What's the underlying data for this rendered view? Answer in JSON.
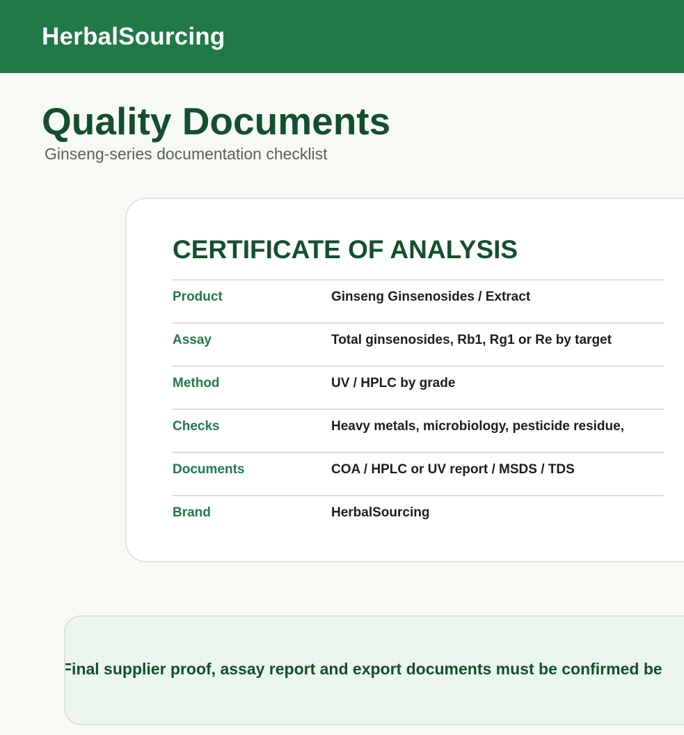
{
  "header": {
    "brand": "HerbalSourcing"
  },
  "page": {
    "title": "Quality Documents",
    "subtitle": "Ginseng-series documentation checklist"
  },
  "certificate": {
    "title": "CERTIFICATE OF ANALYSIS",
    "rows": [
      {
        "label": "Product",
        "value": "Ginseng Ginsenosides / Extract"
      },
      {
        "label": "Assay",
        "value": "Total ginsenosides, Rb1, Rg1 or Re by target"
      },
      {
        "label": "Method",
        "value": "UV / HPLC by grade"
      },
      {
        "label": "Checks",
        "value": "Heavy metals, microbiology, pesticide residue,"
      },
      {
        "label": "Documents",
        "value": "COA / HPLC or UV report / MSDS / TDS"
      },
      {
        "label": "Brand",
        "value": "HerbalSourcing"
      }
    ]
  },
  "notice": {
    "text": "Final supplier proof, assay report and export documents must be confirmed be"
  },
  "colors": {
    "header_bg": "#207a47",
    "title_green": "#134f2e",
    "label_green": "#217a48",
    "page_bg": "#f7faf4",
    "notice_bg": "#ebf5ec"
  }
}
